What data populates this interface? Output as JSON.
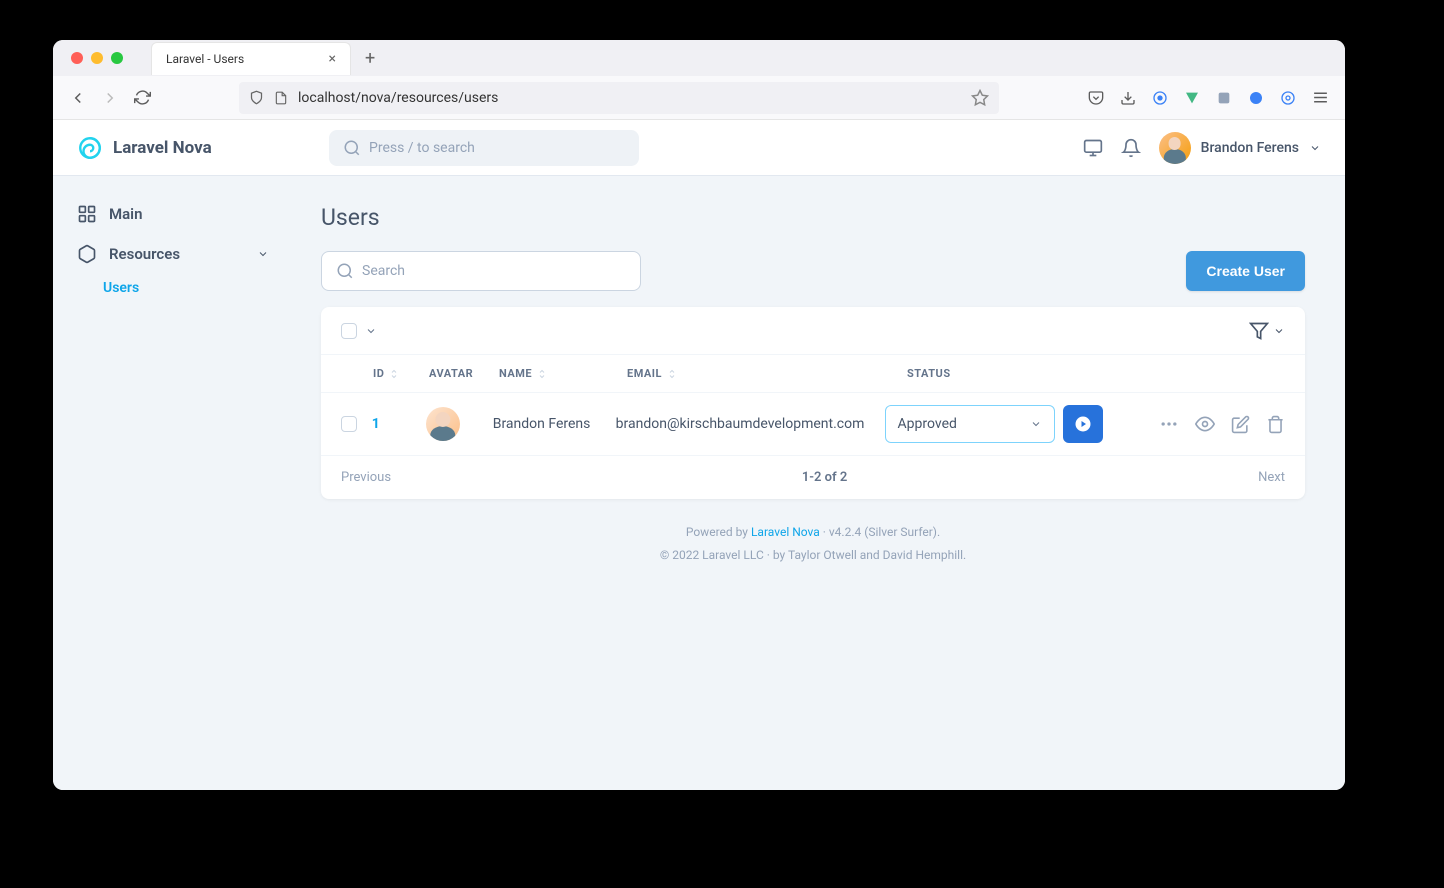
{
  "browser": {
    "tab_title": "Laravel - Users",
    "url": "localhost/nova/resources/users"
  },
  "header": {
    "app_name": "Laravel Nova",
    "search_placeholder": "Press / to search",
    "user_name": "Brandon Ferens"
  },
  "sidebar": {
    "main_label": "Main",
    "resources_label": "Resources",
    "users_label": "Users"
  },
  "page": {
    "title": "Users",
    "search_placeholder": "Search",
    "create_button": "Create User"
  },
  "table": {
    "columns": {
      "id": "ID",
      "avatar": "AVATAR",
      "name": "NAME",
      "email": "EMAIL",
      "status": "STATUS"
    },
    "rows": [
      {
        "id": "1",
        "name": "Brandon Ferens",
        "email": "brandon@kirschbaumdevelopment.com",
        "status": "Approved"
      }
    ]
  },
  "pagination": {
    "previous": "Previous",
    "info": "1-2 of 2",
    "next": "Next"
  },
  "footer": {
    "powered_prefix": "Powered by ",
    "powered_link": "Laravel Nova",
    "version": " · v4.2.4 (Silver Surfer).",
    "copyright": "© 2022 Laravel LLC · by Taylor Otwell and David Hemphill."
  }
}
